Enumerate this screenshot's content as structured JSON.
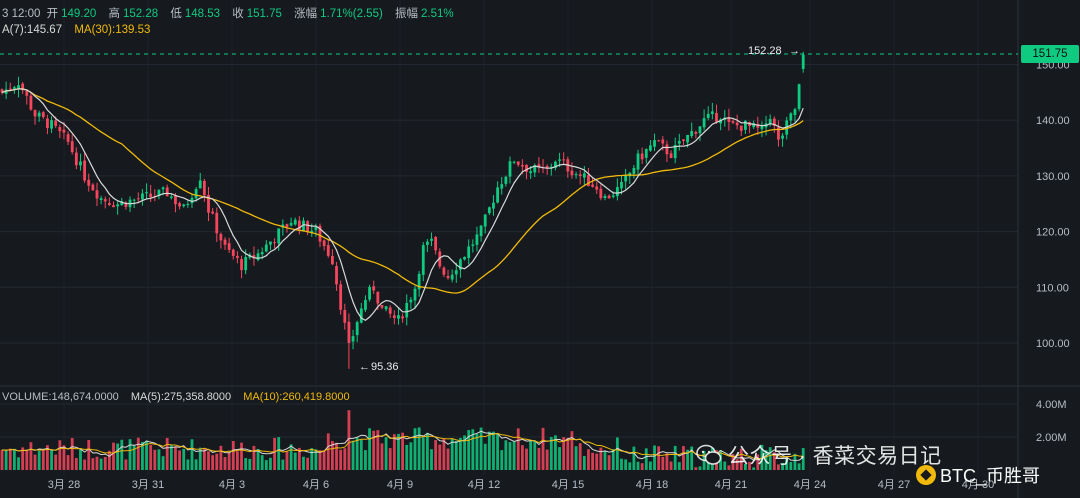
{
  "header": {
    "time": "3 12:00",
    "open_label": "开",
    "open": "149.20",
    "high_label": "高",
    "high": "152.28",
    "low_label": "低",
    "low": "148.53",
    "close_label": "收",
    "close": "151.75",
    "change_label": "涨幅",
    "change": "1.71%(2.55)",
    "amp_label": "振幅",
    "amp": "2.51%"
  },
  "ma_legend": {
    "ma7": "A(7):145.67",
    "ma30": "MA(30):139.53"
  },
  "volume_legend": {
    "volume": "VOLUME:148,674.0000",
    "ma5": "MA(5):275,358.8000",
    "ma10": "MA(10):260,419.8000"
  },
  "price_tag": "151.75",
  "annotations": {
    "high": "152.28",
    "low": "95.36"
  },
  "watermark": "公众号 · 香菜交易日记",
  "brand": "BTC_币胜哥",
  "colors": {
    "up": "#0ecb81",
    "down": "#f6465d",
    "ma7": "#d9d9d9",
    "ma30": "#f0b90b",
    "bg": "#161a1e"
  },
  "chart_data": {
    "type": "candlestick",
    "interval": "4h",
    "y_ticks": [
      "100.00",
      "110.00",
      "120.00",
      "130.00",
      "140.00",
      "150.00"
    ],
    "y_range": [
      94,
      153
    ],
    "volume_ticks": [
      "2.00M",
      "4.00M"
    ],
    "volume_range": [
      0,
      5000000
    ],
    "x_ticks": [
      "3月 28",
      "3月 31",
      "4月 3",
      "4月 6",
      "4月 9",
      "4月 12",
      "4月 15",
      "4月 18",
      "4月 21",
      "4月 24",
      "4月 27",
      "4月 30"
    ],
    "current_price": 151.75,
    "high_marker": 152.28,
    "low_marker": 95.36,
    "anchors": [
      [
        0,
        145
      ],
      [
        4,
        147
      ],
      [
        8,
        141
      ],
      [
        12,
        139
      ],
      [
        16,
        136
      ],
      [
        20,
        130
      ],
      [
        24,
        126
      ],
      [
        28,
        125
      ],
      [
        34,
        126
      ],
      [
        40,
        127
      ],
      [
        44,
        124
      ],
      [
        48,
        130
      ],
      [
        50,
        124
      ],
      [
        54,
        117
      ],
      [
        58,
        114
      ],
      [
        62,
        116
      ],
      [
        66,
        119
      ],
      [
        70,
        122
      ],
      [
        76,
        120
      ],
      [
        80,
        115
      ],
      [
        82,
        107
      ],
      [
        84,
        99
      ],
      [
        86,
        104
      ],
      [
        88,
        108
      ],
      [
        90,
        110
      ],
      [
        92,
        106
      ],
      [
        96,
        104
      ],
      [
        100,
        110
      ],
      [
        102,
        117
      ],
      [
        104,
        118
      ],
      [
        106,
        114
      ],
      [
        108,
        112
      ],
      [
        112,
        116
      ],
      [
        116,
        120
      ],
      [
        118,
        124
      ],
      [
        120,
        128
      ],
      [
        124,
        133
      ],
      [
        128,
        131
      ],
      [
        132,
        131
      ],
      [
        134,
        133
      ],
      [
        140,
        130
      ],
      [
        144,
        128
      ],
      [
        146,
        126
      ],
      [
        150,
        128
      ],
      [
        154,
        133
      ],
      [
        158,
        136
      ],
      [
        162,
        134
      ],
      [
        166,
        137
      ],
      [
        170,
        140
      ],
      [
        174,
        141
      ],
      [
        176,
        139
      ],
      [
        180,
        139
      ],
      [
        184,
        138
      ],
      [
        186,
        141
      ],
      [
        188,
        136
      ],
      [
        190,
        139
      ],
      [
        192,
        142
      ],
      [
        193,
        146
      ],
      [
        194,
        151.75
      ]
    ]
  }
}
